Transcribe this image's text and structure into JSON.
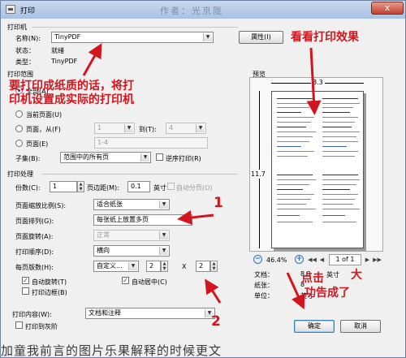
{
  "window": {
    "title": "打印",
    "ghost_title": "作者：光京陇",
    "close_label": "x"
  },
  "printer": {
    "group_label": "打印机",
    "name_label": "名称(N):",
    "name_value": "TinyPDF",
    "status_label": "状态：",
    "status_value": "就绪",
    "type_label": "类型：",
    "type_value": "TinyPDF",
    "properties_button": "属性(I)"
  },
  "range": {
    "group_label": "打印范围",
    "all_label": "全部(A)",
    "current_label": "当前页面(U)",
    "pages_from_label": "页面，从(F)",
    "from_value": "1",
    "to_label": "到(T):",
    "to_value": "4",
    "pages_e_label": "页面(E)",
    "pages_e_value": "1-4",
    "subset_label": "子集(B):",
    "subset_value": "范围中的所有页",
    "reverse_label": "逆序打印(R)"
  },
  "handling": {
    "group_label": "打印处理",
    "copies_label": "份数(C):",
    "copies_value": "1",
    "margin_label": "页边距(M):",
    "margin_value": "0.1",
    "margin_unit": "英寸",
    "collate_label": "自动分页(O)",
    "scaling_label": "页面缩放比例(S):",
    "scaling_value": "适合纸张",
    "arrange_label": "页面排列(G):",
    "arrange_value": "每张纸上放置多页",
    "rotate_label": "页面旋转(A):",
    "rotate_value": "正常",
    "order_label": "打印顺序(D):",
    "order_value": "横向",
    "per_sheet_label": "每页版数(H):",
    "per_sheet_value": "自定义...",
    "cols_value": "2",
    "x_label": "X",
    "rows_value": "2",
    "auto_rotate_label": "自动旋转(T)",
    "auto_center_label": "自动居中(C)",
    "border_label": "打印边框(B)"
  },
  "content": {
    "label": "打印内容(W):",
    "value": "文档和注释",
    "grayscale_label": "打印到灰阶"
  },
  "preview": {
    "group_label": "预览",
    "width_label": "8.3",
    "height_label": "11.7",
    "zoom_value": "46.4%",
    "page_indicator": "1 of 1",
    "doc_label": "文档：",
    "doc_value": "8.3",
    "paper_label": "纸张：",
    "paper_value": "8",
    "unit_label": "单位：",
    "unit_value": "英寸",
    "unit_cut_value": "英寸"
  },
  "buttons": {
    "ok": "确定",
    "cancel": "取消"
  },
  "annotations": {
    "top_right": "看看打印效果",
    "left_line1": "要打印成纸质的话，将打",
    "left_line2": "印机设置成实际的打印机",
    "num1": "1",
    "num2": "2",
    "bottom_right_line1": "点击",
    "bottom_right_line1b": "大",
    "bottom_right_line2": "功告成了",
    "bottom_overlay": "加童我前言的图片乐果解释的时候更文"
  },
  "colors": {
    "annotation_red": "#d3151d",
    "dialog_bg": "#f0f0f0",
    "link_blue": "#3b5bb4"
  }
}
